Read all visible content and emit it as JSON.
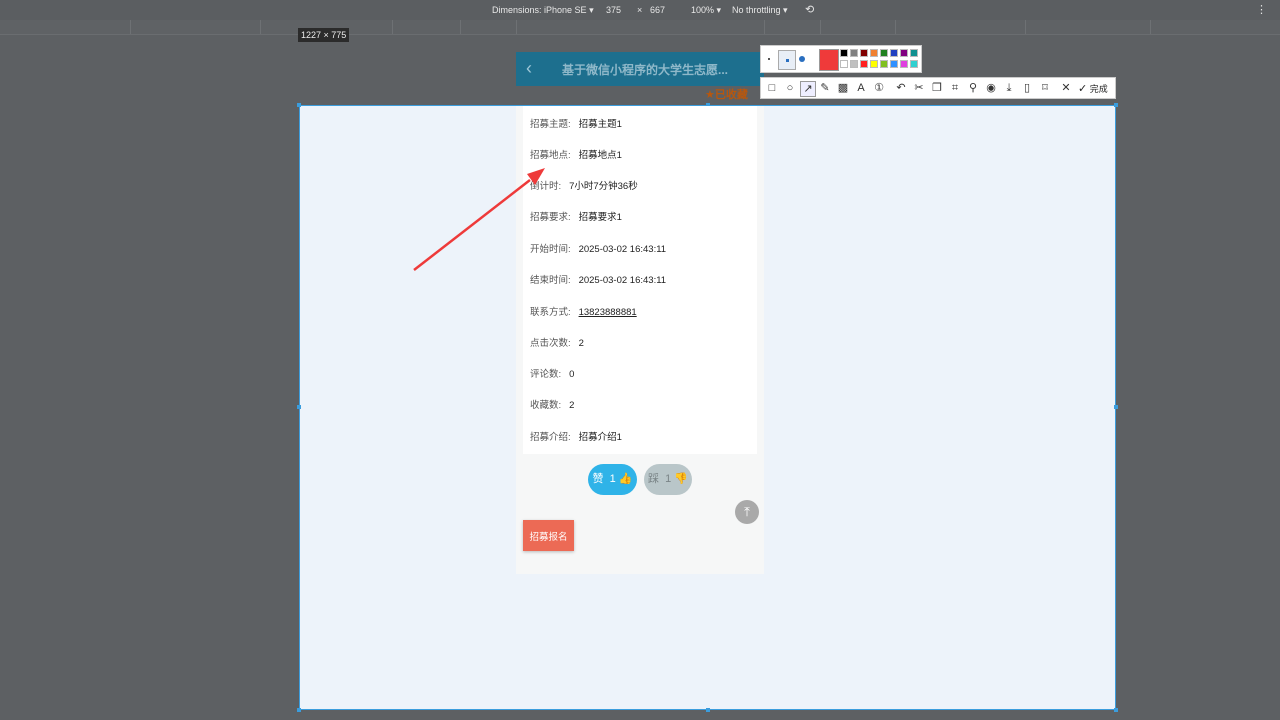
{
  "devtools": {
    "dimensions_label": "Dimensions: iPhone SE",
    "width": "375",
    "times": "×",
    "height": "667",
    "zoom": "100%",
    "throttling": "No throttling"
  },
  "capture": {
    "size_badge": "1227 × 775"
  },
  "phone": {
    "title": "基于微信小程序的大学生志愿...",
    "favorite_label": "已收藏",
    "fields": [
      {
        "label": "招募主题:",
        "value": "招募主题1"
      },
      {
        "label": "招募地点:",
        "value": "招募地点1"
      },
      {
        "label": "倒计时:",
        "value": "7小时7分钟36秒"
      },
      {
        "label": "招募要求:",
        "value": "招募要求1"
      },
      {
        "label": "开始时间:",
        "value": "2025-03-02 16:43:11"
      },
      {
        "label": "结束时间:",
        "value": "2025-03-02 16:43:11"
      },
      {
        "label": "联系方式:",
        "value": "13823888881"
      },
      {
        "label": "点击次数:",
        "value": "2"
      },
      {
        "label": "评论数:",
        "value": "0"
      },
      {
        "label": "收藏数:",
        "value": "2"
      },
      {
        "label": "招募介绍:",
        "value": "招募介绍1"
      }
    ],
    "like": {
      "label": "赞",
      "count": "1"
    },
    "dislike": {
      "label": "踩",
      "count": "1"
    },
    "apply_label": "招募报名",
    "colors": {
      "header": "#1d6f8e",
      "like": "#2fb3e8",
      "apply": "#ec6a55"
    }
  },
  "toolbar": {
    "done_label": "完成",
    "selected_color": "#ef3a3a",
    "palette": [
      "#000000",
      "#808080",
      "#800000",
      "#f08030",
      "#208020",
      "#2040c0",
      "#800080",
      "#109090",
      "#ffffff",
      "#c0c0c0",
      "#ff2020",
      "#ffff00",
      "#80c020",
      "#3090ff",
      "#e040e0",
      "#30d0d0"
    ],
    "tools": [
      "rect-tool-icon",
      "ellipse-tool-icon",
      "arrow-tool-icon",
      "pen-tool-icon",
      "mosaic-tool-icon",
      "text-tool-icon",
      "number-tool-icon",
      "undo-icon",
      "cut-icon",
      "copy-icon",
      "ocr-icon",
      "pin-icon",
      "record-icon",
      "download-icon",
      "phone-icon",
      "bookmark-icon",
      "close-icon",
      "check-icon"
    ]
  }
}
